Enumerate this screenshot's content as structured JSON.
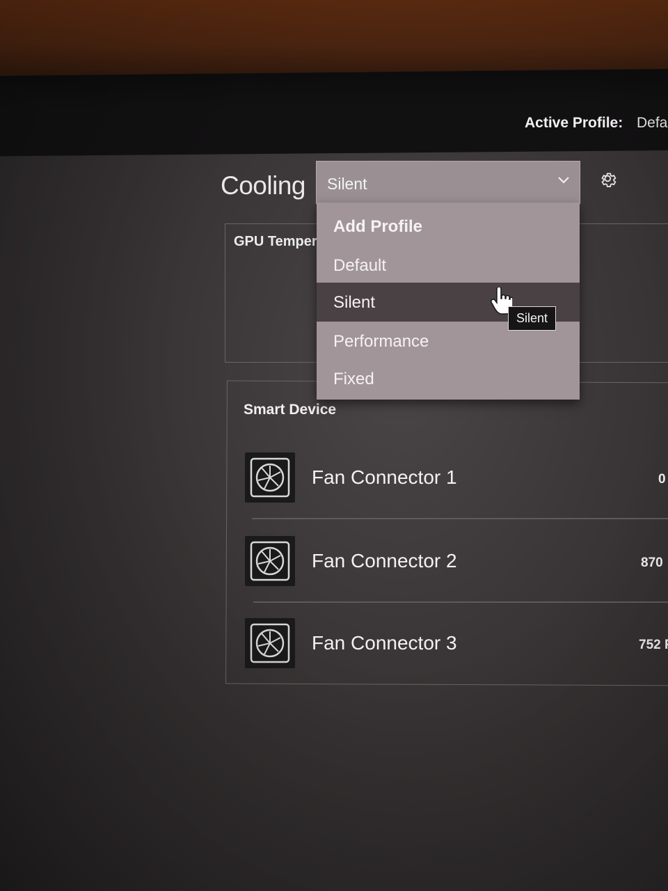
{
  "header": {
    "active_profile_label": "Active Profile:",
    "active_profile_value": "Defa"
  },
  "cooling": {
    "title": "Cooling",
    "selected_profile": "Silent",
    "dropdown_options": [
      "Add Profile",
      "Default",
      "Silent",
      "Performance",
      "Fixed"
    ],
    "tooltip": "Silent"
  },
  "gpu_panel": {
    "label": "GPU Temper"
  },
  "smart_device": {
    "title": "Smart Device",
    "fans": [
      {
        "name": "Fan Connector 1",
        "rpm": "0"
      },
      {
        "name": "Fan Connector 2",
        "rpm": "870"
      },
      {
        "name": "Fan Connector 3",
        "rpm": "752 F"
      }
    ]
  },
  "icons": {
    "settings": "gear-icon",
    "dropdown": "chevron-down-icon",
    "fan": "fan-icon",
    "cursor": "hand-pointer-icon"
  },
  "colors": {
    "header_bg": "#121112",
    "dropdown_bg": "#a1959a",
    "selected_item_bg": "#4a4145"
  }
}
